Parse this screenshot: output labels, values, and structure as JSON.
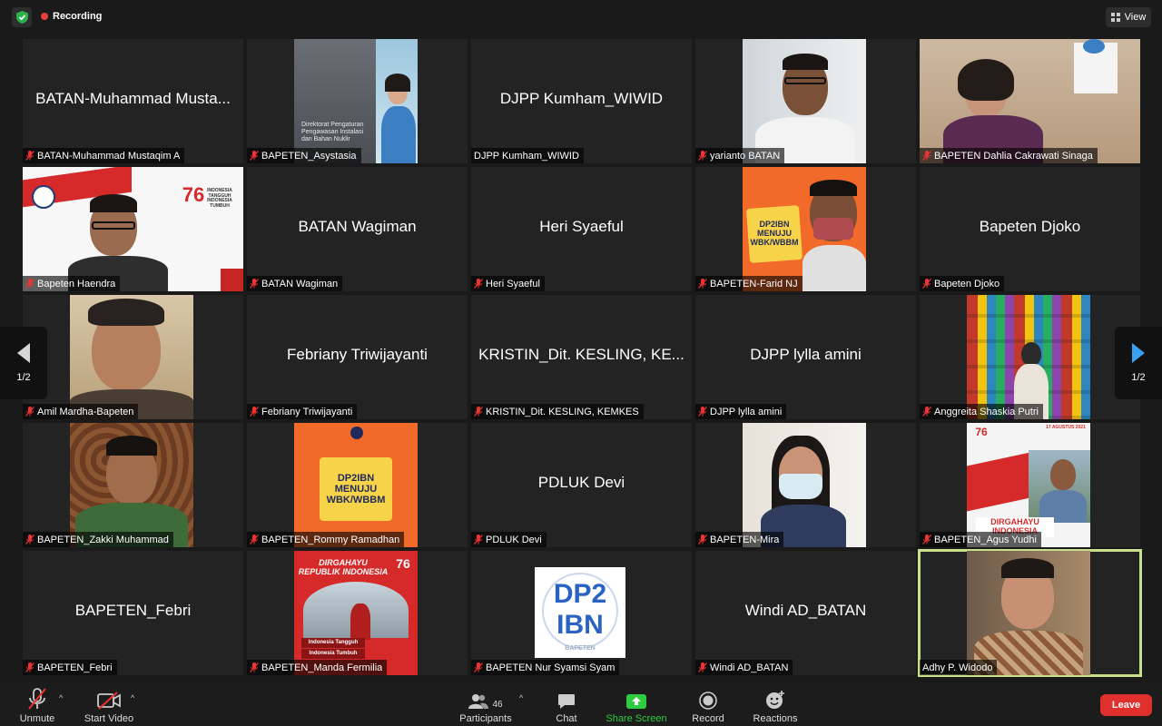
{
  "status": {
    "recording_label": "Recording",
    "recording_color": "#e6403d",
    "view_label": "View"
  },
  "pagination": {
    "left_page": "1/2",
    "right_page": "1/2",
    "arrow_color": "#3aa0f2"
  },
  "tiles": [
    {
      "name": "BATAN-Muhammad Mustaqim A",
      "display": "BATAN-Muhammad Musta...",
      "video": false,
      "muted": true
    },
    {
      "name": "BAPETEN_Asystasia",
      "display": "",
      "video": true,
      "muted": true
    },
    {
      "name": "DJPP Kumham_WIWID",
      "display": "DJPP Kumham_WIWID",
      "video": false,
      "muted": false
    },
    {
      "name": "yarianto BATAN",
      "display": "",
      "video": true,
      "muted": true
    },
    {
      "name": "BAPETEN Dahlia Cakrawati Sinaga",
      "display": "",
      "video": true,
      "muted": true
    },
    {
      "name": "Bapeten Haendra",
      "display": "",
      "video": true,
      "muted": true
    },
    {
      "name": "BATAN Wagiman",
      "display": "BATAN Wagiman",
      "video": false,
      "muted": true
    },
    {
      "name": "Heri Syaeful",
      "display": "Heri Syaeful",
      "video": false,
      "muted": true
    },
    {
      "name": "BAPETEN-Farid NJ",
      "display": "",
      "video": true,
      "muted": true
    },
    {
      "name": "Bapeten Djoko",
      "display": "Bapeten Djoko",
      "video": false,
      "muted": true
    },
    {
      "name": "Amil Mardha-Bapeten",
      "display": "",
      "video": true,
      "muted": true
    },
    {
      "name": "Febriany Triwijayanti",
      "display": "Febriany Triwijayanti",
      "video": false,
      "muted": true
    },
    {
      "name": "KRISTIN_Dit. KESLING, KEMKES",
      "display": "KRISTIN_Dit. KESLING, KE...",
      "video": false,
      "muted": true
    },
    {
      "name": "DJPP lylla amini",
      "display": "DJPP lylla amini",
      "video": false,
      "muted": true
    },
    {
      "name": "Anggreita Shaskia Putri",
      "display": "",
      "video": true,
      "muted": true
    },
    {
      "name": "BAPETEN_Zakki Muhammad",
      "display": "",
      "video": true,
      "muted": true
    },
    {
      "name": "BAPETEN_Rommy Ramadhan",
      "display": "",
      "video": true,
      "muted": true
    },
    {
      "name": "PDLUK Devi",
      "display": "PDLUK Devi",
      "video": false,
      "muted": true
    },
    {
      "name": "BAPETEN-Mira",
      "display": "",
      "video": true,
      "muted": true
    },
    {
      "name": "BAPETEN_Agus Yudhi",
      "display": "",
      "video": true,
      "muted": true
    },
    {
      "name": "BAPETEN_Febri",
      "display": "BAPETEN_Febri",
      "video": false,
      "muted": true
    },
    {
      "name": "BAPETEN_Manda Fermilia",
      "display": "",
      "video": true,
      "muted": true
    },
    {
      "name": "BAPETEN Nur Syamsi Syam",
      "display": "",
      "video": true,
      "muted": true
    },
    {
      "name": "Windi AD_BATAN",
      "display": "Windi AD_BATAN",
      "video": false,
      "muted": true
    },
    {
      "name": "Adhy P. Widodo",
      "display": "",
      "video": true,
      "muted": false,
      "active": true
    }
  ],
  "posters": {
    "asystasia_slide": "Direktorat Pengaturan Pengawasan Instalasi dan Bahan Nuklir",
    "haendra_76": "76",
    "haendra_tagline": "INDONESIA TANGGUH INDONESIA TUMBUH",
    "farid_sign": "DP2IBN MENUJU WBK/WBBM",
    "rommy_sign": "DP2IBN MENUJU WBK/WBBM",
    "agus_banner": "DIRGAHAYU INDONESIA",
    "agus_date": "17 AGUSTUS 2021",
    "manda_title": "DIRGAHAYU REPUBLIK INDONESIA",
    "manda_line1": "Indonesia Tangguh",
    "manda_line2": "Indonesia Tumbuh",
    "nur_logo_1": "DP2",
    "nur_logo_2": "IBN",
    "nur_logo_ring": "BAPETEN"
  },
  "toolbar": {
    "unmute": "Unmute",
    "start_video": "Start Video",
    "participants": "Participants",
    "participant_count": "46",
    "chat": "Chat",
    "share_screen": "Share Screen",
    "record": "Record",
    "reactions": "Reactions",
    "leave": "Leave",
    "share_color": "#2ecc40",
    "leave_color": "#e0302d",
    "active_speaker_color": "#c8e08c"
  }
}
